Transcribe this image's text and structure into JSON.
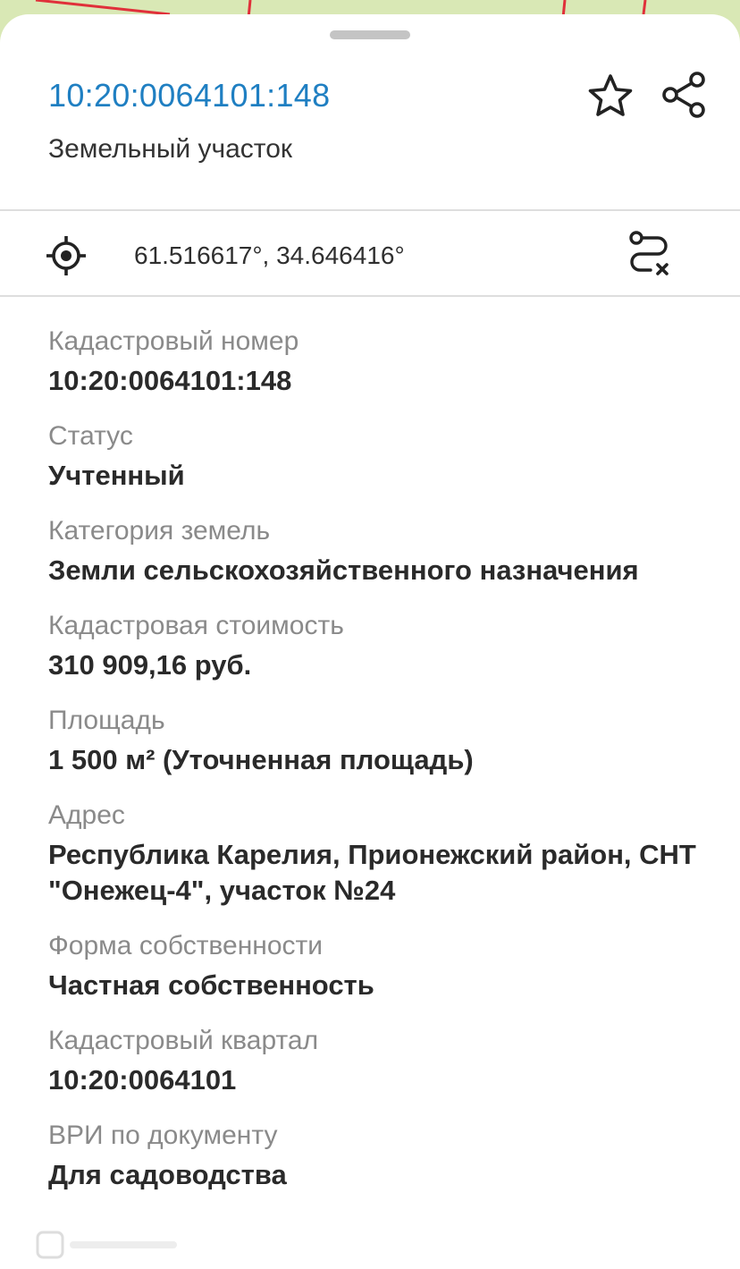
{
  "card": {
    "title": "10:20:0064101:148",
    "subtitle": "Земельный участок",
    "coordinates": "61.516617°, 34.646416°"
  },
  "icons": {
    "favorite": "star-outline-icon",
    "share": "share-icon",
    "locate": "crosshair-icon",
    "route": "route-remove-icon"
  },
  "fields": [
    {
      "label": "Кадастровый номер",
      "value": "10:20:0064101:148"
    },
    {
      "label": "Статус",
      "value": "Учтенный"
    },
    {
      "label": "Категория земель",
      "value": "Земли сельскохозяйственного назначения"
    },
    {
      "label": "Кадастровая стоимость",
      "value": "310 909,16 руб."
    },
    {
      "label": "Площадь",
      "value": "1 500 м² (Уточненная площадь)"
    },
    {
      "label": "Адрес",
      "value": "Республика Карелия, Прионежский район, СНТ \"Онежец-4\", участок №24"
    },
    {
      "label": "Форма собственности",
      "value": "Частная собственность"
    },
    {
      "label": "Кадастровый квартал",
      "value": "10:20:0064101"
    },
    {
      "label": "ВРИ по документу",
      "value": "Для садоводства"
    }
  ],
  "colors": {
    "accent": "#1f7fc2",
    "map_background": "#d7e7b2",
    "parcel_border": "#e0303a"
  }
}
